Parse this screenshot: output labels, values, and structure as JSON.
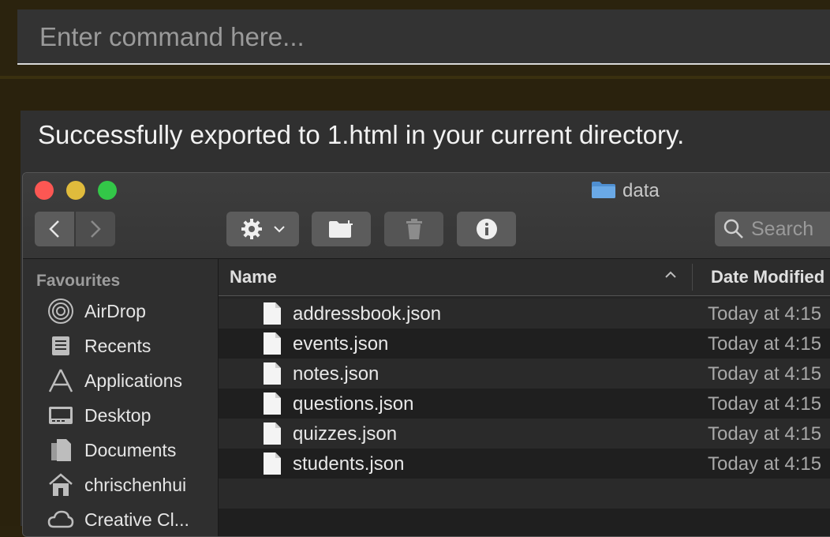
{
  "command_bar": {
    "placeholder": "Enter command here..."
  },
  "result": {
    "message": "Successfully exported to 1.html in your current directory."
  },
  "finder": {
    "window_title": "data",
    "toolbar": {
      "action_icon": "gear-icon",
      "new_folder_icon": "new-folder-icon",
      "trash_icon": "trash-icon",
      "info_icon": "info-icon",
      "search_placeholder": "Search"
    },
    "sidebar": {
      "section_title": "Favourites",
      "items": [
        {
          "label": "AirDrop",
          "icon": "airdrop-icon"
        },
        {
          "label": "Recents",
          "icon": "recents-icon"
        },
        {
          "label": "Applications",
          "icon": "applications-icon"
        },
        {
          "label": "Desktop",
          "icon": "desktop-icon"
        },
        {
          "label": "Documents",
          "icon": "documents-icon"
        },
        {
          "label": "chrischenhui",
          "icon": "home-icon"
        },
        {
          "label": "Creative Cl...",
          "icon": "creative-cloud-icon"
        }
      ]
    },
    "columns": {
      "name": "Name",
      "date_modified": "Date Modified"
    },
    "files": [
      {
        "name": "addressbook.json",
        "date": "Today at 4:15"
      },
      {
        "name": "events.json",
        "date": "Today at 4:15"
      },
      {
        "name": "notes.json",
        "date": "Today at 4:15"
      },
      {
        "name": "questions.json",
        "date": "Today at 4:15"
      },
      {
        "name": "quizzes.json",
        "date": "Today at 4:15"
      },
      {
        "name": "students.json",
        "date": "Today at 4:15"
      }
    ]
  }
}
